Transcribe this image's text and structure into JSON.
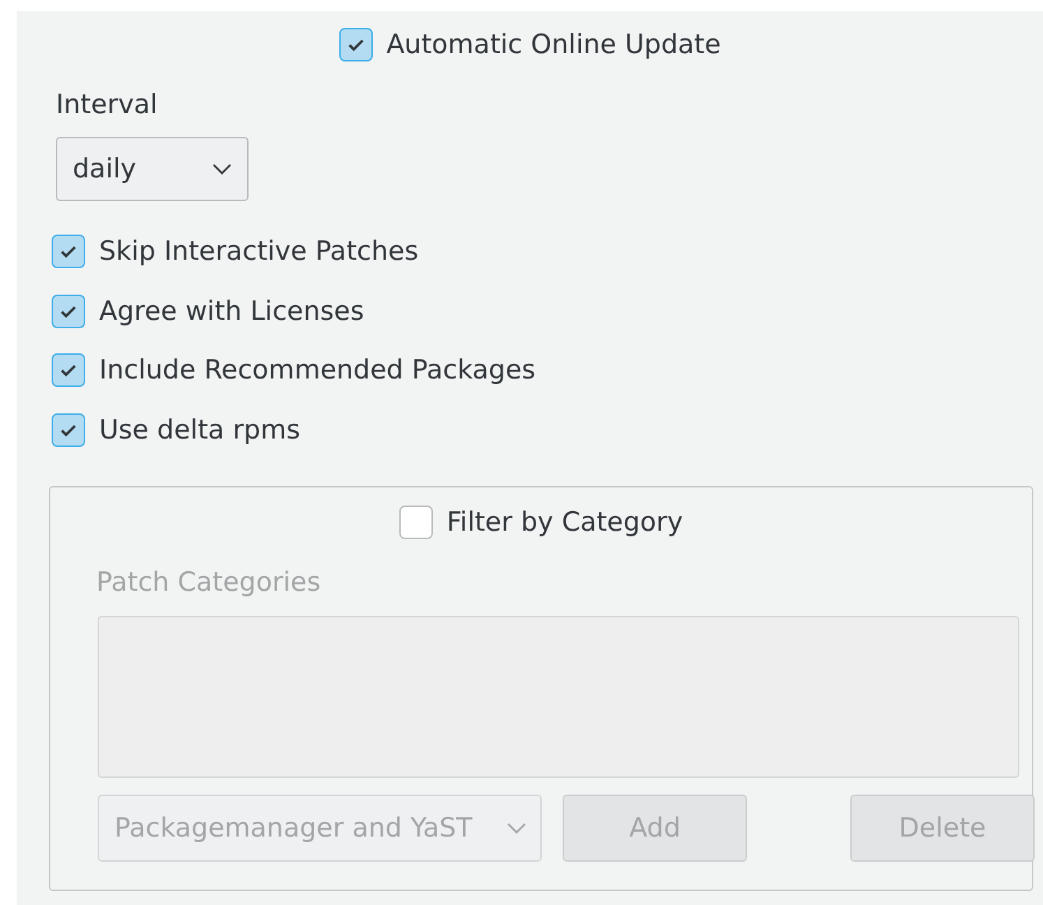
{
  "automatic_update": {
    "label": "Automatic Online Update",
    "checked": true
  },
  "interval": {
    "label": "Interval",
    "value": "daily"
  },
  "options": [
    {
      "label": "Skip Interactive Patches",
      "checked": true
    },
    {
      "label": "Agree with Licenses",
      "checked": true
    },
    {
      "label": "Include Recommended Packages",
      "checked": true
    },
    {
      "label": "Use delta rpms",
      "checked": true
    }
  ],
  "filter_group": {
    "label": "Filter by Category",
    "checked": false,
    "list_label": "Patch Categories",
    "disabled": true,
    "category": {
      "value": "Packagemanager and YaST"
    },
    "buttons": [
      {
        "label": "Add"
      },
      {
        "label": "Delete"
      }
    ]
  }
}
